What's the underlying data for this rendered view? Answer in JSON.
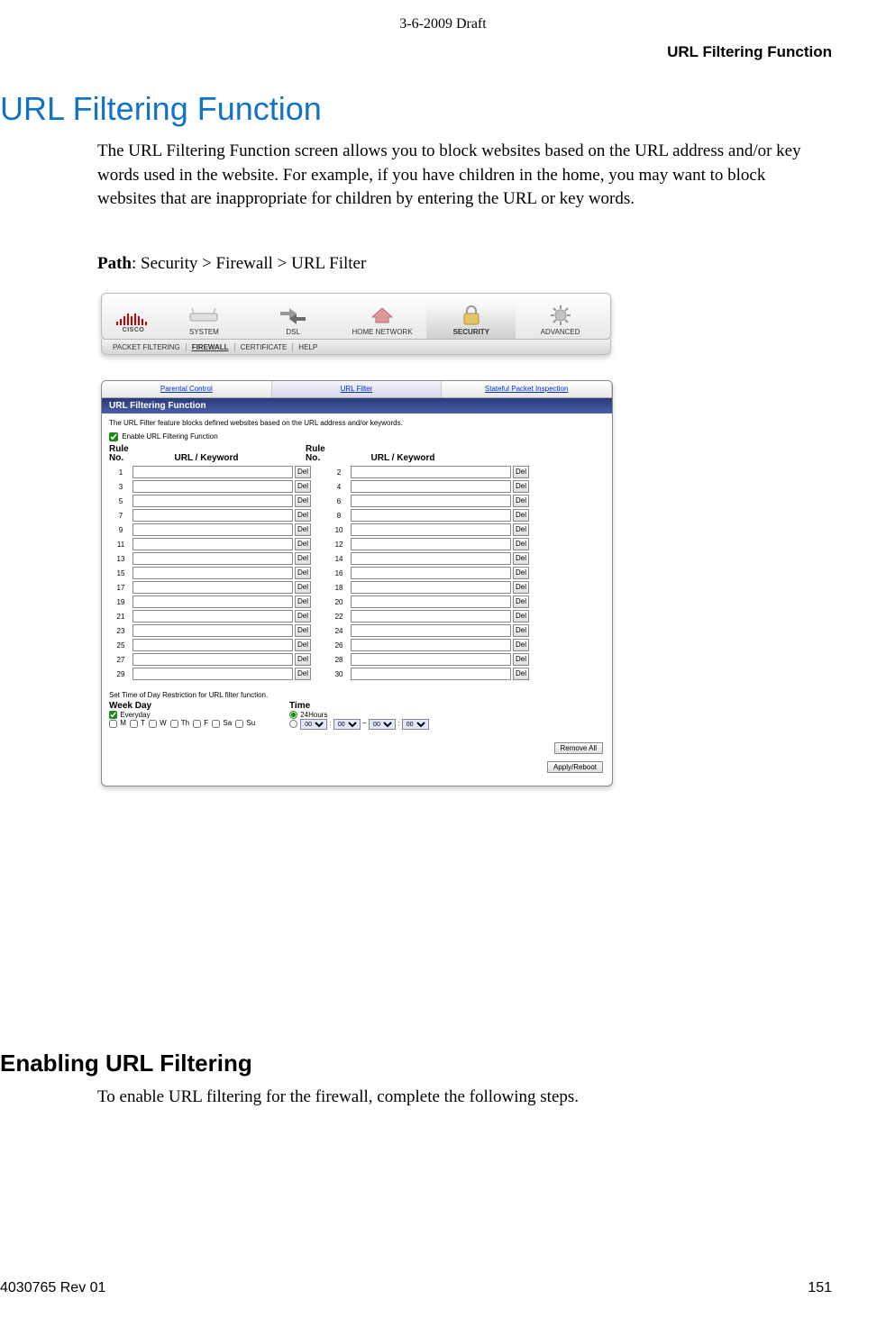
{
  "header": {
    "draft": "3-6-2009 Draft",
    "section": "URL Filtering Function"
  },
  "h1": "URL Filtering Function",
  "intro": "The URL Filtering Function screen allows you to block websites based on the URL address and/or key words used in the website. For example, if you have children in the home, you may want to block websites that are inappropriate for children by entering the URL or key words.",
  "path": {
    "label": "Path",
    "value": ":  Security > Firewall > URL Filter"
  },
  "screenshot": {
    "logo_text": "CISCO",
    "nav": [
      {
        "label": "SYSTEM",
        "active": false
      },
      {
        "label": "DSL",
        "active": false
      },
      {
        "label": "HOME NETWORK",
        "active": false
      },
      {
        "label": "SECURITY",
        "active": true
      },
      {
        "label": "ADVANCED",
        "active": false
      }
    ],
    "subnav": [
      {
        "label": "PACKET FILTERING",
        "active": false
      },
      {
        "label": "FIREWALL",
        "active": true
      },
      {
        "label": "CERTIFICATE",
        "active": false
      },
      {
        "label": "HELP",
        "active": false
      }
    ],
    "tabs": [
      {
        "label": "Parental Control",
        "active": false
      },
      {
        "label": "URL Filter",
        "active": true
      },
      {
        "label": "Stateful Packet Inspection",
        "active": false
      }
    ],
    "panel_title": "URL Filtering Function",
    "panel_desc": "The URL Filter feature blocks defined websites based on the URL address and/or keywords.",
    "enable_label": "Enable URL Filtering Function",
    "enable_checked": true,
    "rule_header": {
      "no": "Rule No.",
      "kw": "URL / Keyword"
    },
    "del_label": "Del",
    "numbers_left": [
      "1",
      "3",
      "5",
      "7",
      "9",
      "11",
      "13",
      "15",
      "17",
      "19",
      "21",
      "23",
      "25",
      "27",
      "29"
    ],
    "numbers_right": [
      "2",
      "4",
      "6",
      "8",
      "10",
      "12",
      "14",
      "16",
      "18",
      "20",
      "22",
      "24",
      "26",
      "28",
      "30"
    ],
    "time_title": "Set Time of Day Restriction for URL filter function.",
    "weekday": {
      "title": "Week Day",
      "everyday": "Everyday",
      "everyday_checked": true,
      "days": [
        "M",
        "T",
        "W",
        "Th",
        "F",
        "Sa",
        "Su"
      ]
    },
    "time": {
      "title": "Time",
      "opt24": "24Hours",
      "opt24_selected": true,
      "hh": "00",
      "mm": "00",
      "sep_tilde": "~"
    },
    "buttons": {
      "remove": "Remove All",
      "apply": "Apply/Reboot"
    }
  },
  "h2": "Enabling URL Filtering",
  "enable_intro": "To enable URL filtering for the firewall, complete the following steps.",
  "footer": {
    "left": "4030765 Rev 01",
    "right": "151"
  }
}
